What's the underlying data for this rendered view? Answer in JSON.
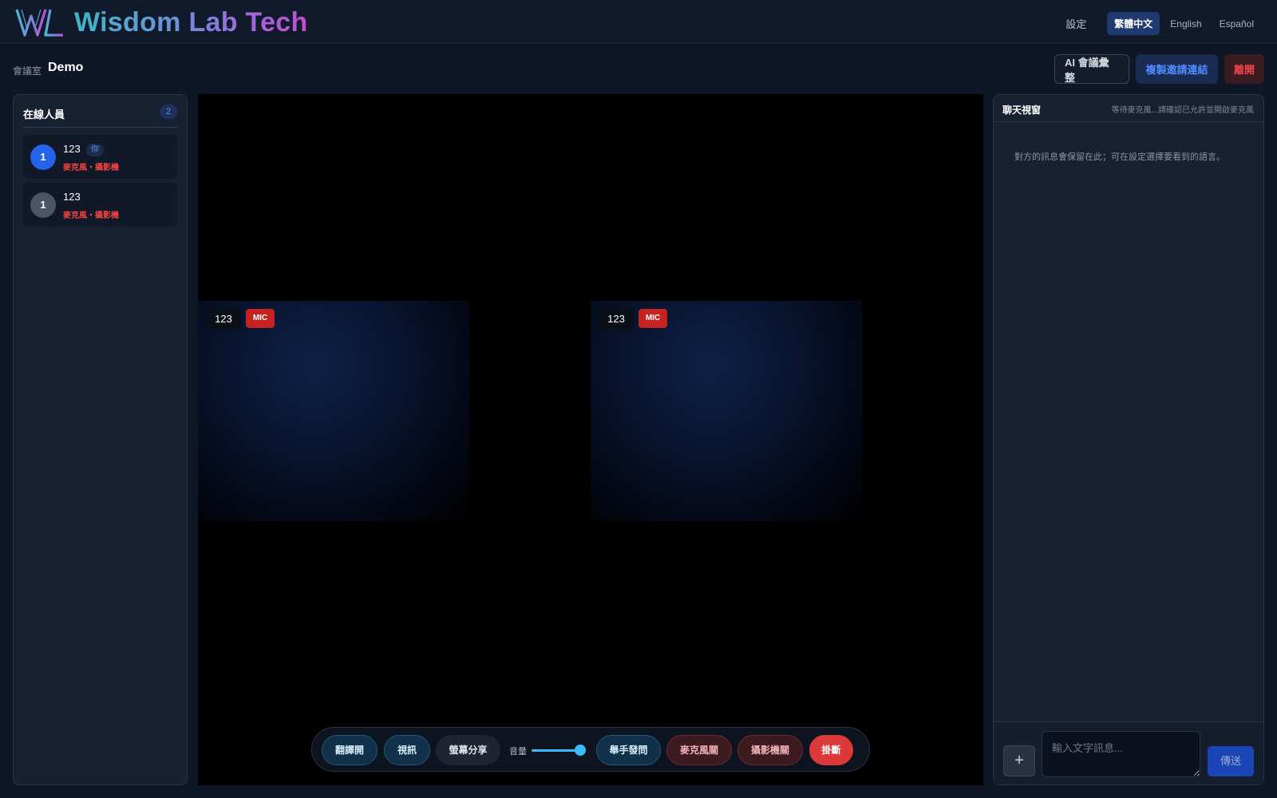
{
  "brand": {
    "name": "Wisdom Lab Tech",
    "logo_icon": "wl-monogram-icon"
  },
  "top_nav": {
    "settings": "設定",
    "languages": [
      {
        "label": "繁體中文",
        "active": true
      },
      {
        "label": "English",
        "active": false
      },
      {
        "label": "Español",
        "active": false
      }
    ]
  },
  "room": {
    "label": "會議室",
    "name": "Demo",
    "actions": {
      "ai_summary": "AI 會議彙整",
      "copy_invite": "複製邀請連結",
      "leave": "離開"
    }
  },
  "participants": {
    "title": "在線人員",
    "count": "2",
    "items": [
      {
        "avatar": "1",
        "name": "123",
        "you_badge": "你",
        "status": "麥克風・攝影機",
        "self": true
      },
      {
        "avatar": "1",
        "name": "123",
        "status": "麥克風・攝影機",
        "self": false
      }
    ]
  },
  "video": {
    "tiles": [
      {
        "name": "123",
        "badge": "MIC"
      },
      {
        "name": "123",
        "badge": "MIC"
      }
    ]
  },
  "controls": {
    "translate": "翻譯開",
    "video": "視訊",
    "screen_share": "螢幕分享",
    "volume_label": "音量",
    "volume_level": 1.0,
    "raise_hand": "舉手發問",
    "mic": "麥克風關",
    "camera": "攝影機關",
    "hangup": "掛斷"
  },
  "chat": {
    "title": "聊天視窗",
    "status": "等待麥克風...請確認已允許並開啟麥克風",
    "hint": "對方的訊息會保留在此；可在設定選擇要看到的語言。",
    "input_placeholder": "輸入文字訊息...",
    "plus_icon": "plus-icon",
    "send": "傳送"
  },
  "colors": {
    "accent": "#2563eb",
    "danger": "#dc3a3a",
    "mic_badge": "#c52222",
    "slider": "#38bdf8"
  }
}
